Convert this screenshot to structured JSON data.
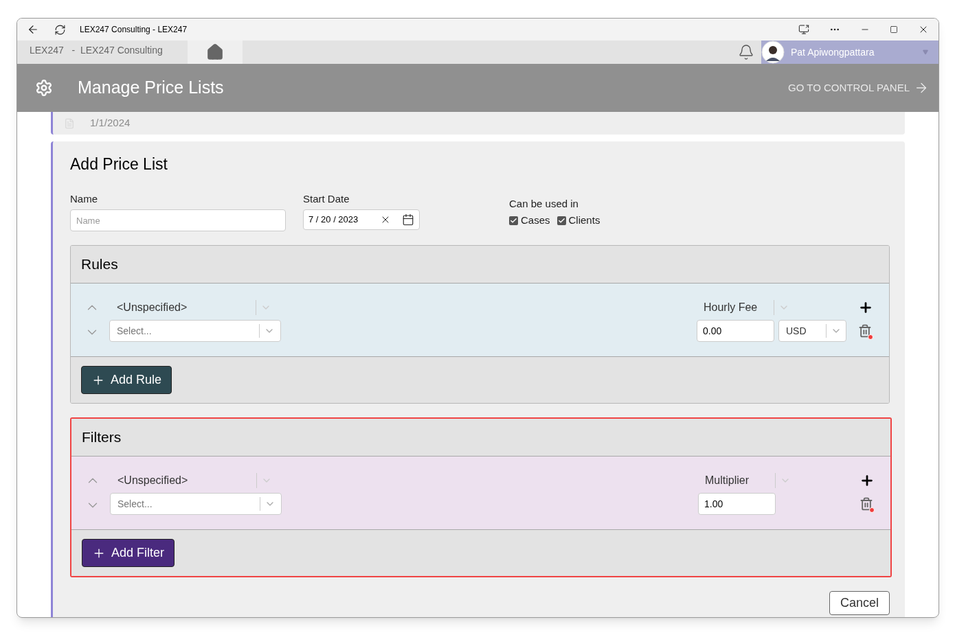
{
  "window": {
    "title": "LEX247 Consulting - LEX247"
  },
  "app_bar": {
    "breadcrumb": "LEX247   -  LEX247 Consulting",
    "user": "Pat Apiwongpattara"
  },
  "header": {
    "title": "Manage Price Lists",
    "link": "GO TO CONTROL PANEL"
  },
  "previous_item": {
    "date": "1/1/2024"
  },
  "form": {
    "title": "Add Price List",
    "name": {
      "label": "Name",
      "placeholder": "Name"
    },
    "start_date": {
      "label": "Start Date",
      "value": "7 / 20 / 2023"
    },
    "usage": {
      "label": "Can be used in",
      "options": [
        {
          "label": "Cases",
          "checked": true
        },
        {
          "label": "Clients",
          "checked": true
        }
      ]
    }
  },
  "sections": [
    {
      "title": "Rules",
      "kind": "rules",
      "highlighted": false,
      "rows": [
        {
          "field": "<Unspecified>",
          "placeholder": "Select...",
          "value_type": "Hourly Fee",
          "value": "0.00",
          "currency": "USD"
        }
      ],
      "add_button": "Add Rule"
    },
    {
      "title": "Filters",
      "kind": "filters",
      "highlighted": true,
      "rows": [
        {
          "field": "<Unspecified>",
          "placeholder": "Select...",
          "value_type": "Multiplier",
          "value": "1.00"
        }
      ],
      "add_button": "Add Filter"
    }
  ],
  "cancel": "Cancel"
}
